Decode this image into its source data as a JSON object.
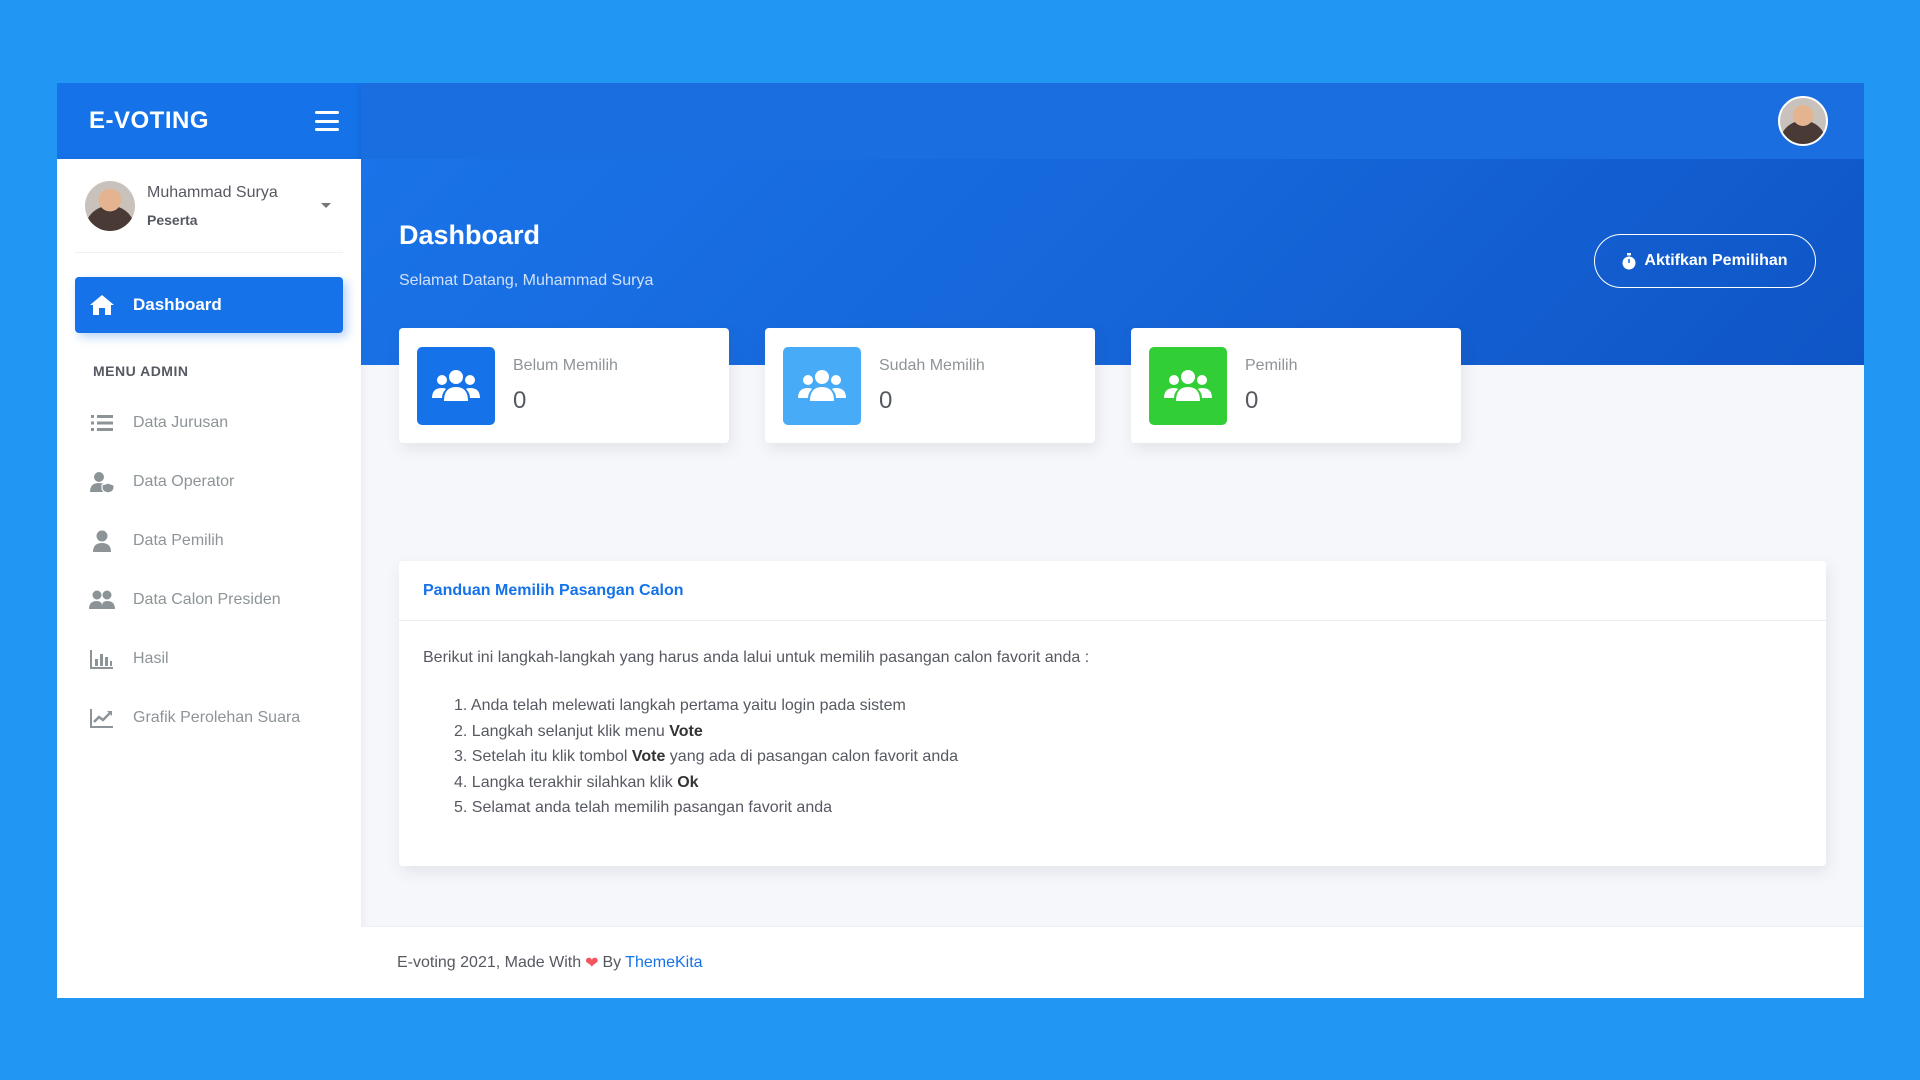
{
  "app": {
    "logo": "E-VOTING"
  },
  "user": {
    "name": "Muhammad Surya",
    "role": "Peserta"
  },
  "sidebar": {
    "active": {
      "label": "Dashboard",
      "icon": "home-icon"
    },
    "section_title": "MENU ADMIN",
    "items": [
      {
        "label": "Data Jurusan",
        "icon": "list-icon"
      },
      {
        "label": "Data Operator",
        "icon": "user-shield-icon"
      },
      {
        "label": "Data Pemilih",
        "icon": "user-icon"
      },
      {
        "label": "Data Calon Presiden",
        "icon": "users-icon"
      },
      {
        "label": "Hasil",
        "icon": "bar-chart-icon"
      },
      {
        "label": "Grafik Perolehan Suara",
        "icon": "line-chart-icon"
      }
    ]
  },
  "header": {
    "title": "Dashboard",
    "subtitle": "Selamat Datang, Muhammad Surya",
    "action_label": "Aktifkan Pemilihan"
  },
  "stats": [
    {
      "label": "Belum Memilih",
      "value": "0",
      "color": "#1572e8",
      "icon": "users-icon"
    },
    {
      "label": "Sudah Memilih",
      "value": "0",
      "color": "#48abf7",
      "icon": "users-icon"
    },
    {
      "label": "Pemilih",
      "value": "0",
      "color": "#31ce36",
      "icon": "users-icon"
    }
  ],
  "guide": {
    "title": "Panduan Memilih Pasangan Calon",
    "intro": "Berikut ini langkah-langkah yang harus anda lalui untuk memilih pasangan calon favorit anda :",
    "steps": [
      {
        "num": "1.",
        "pre": "Anda telah melewati langkah pertama yaitu login pada sistem",
        "bold": "",
        "post": ""
      },
      {
        "num": "2.",
        "pre": "Langkah selanjut klik menu ",
        "bold": "Vote",
        "post": ""
      },
      {
        "num": "3.",
        "pre": "Setelah itu klik tombol ",
        "bold": "Vote",
        "post": " yang ada di pasangan calon favorit anda"
      },
      {
        "num": "4.",
        "pre": "Langka terakhir silahkan klik ",
        "bold": "Ok",
        "post": ""
      },
      {
        "num": "5.",
        "pre": "Selamat anda telah memilih pasangan favorit anda",
        "bold": "",
        "post": ""
      }
    ]
  },
  "footer": {
    "text": "E-voting 2021, Made With",
    "by": "By",
    "link": "ThemeKita"
  },
  "colors": {
    "primary": "#1572e8",
    "info": "#48abf7",
    "success": "#31ce36",
    "background": "#2196f3"
  }
}
